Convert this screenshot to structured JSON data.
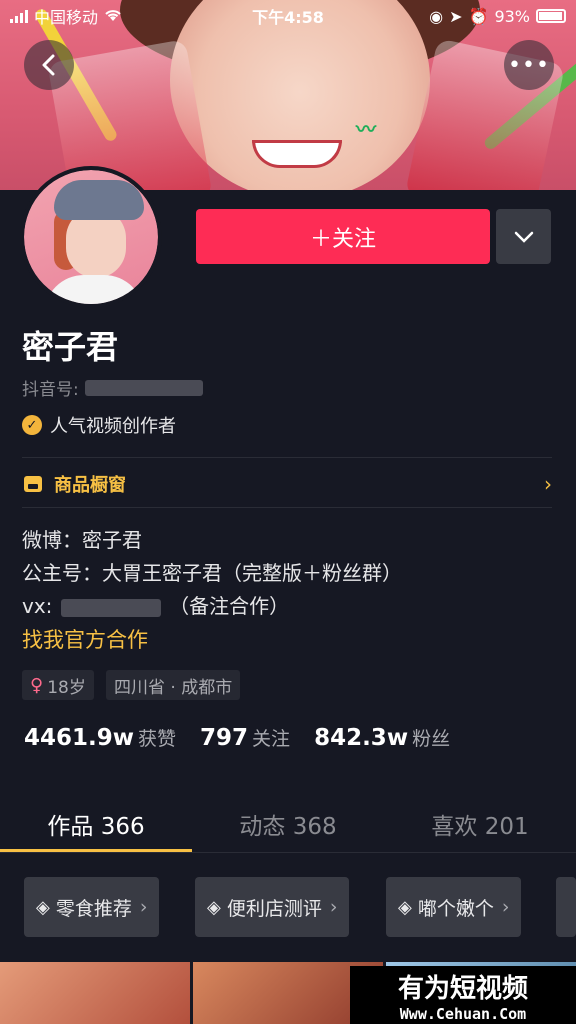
{
  "status_bar": {
    "carrier": "中国移动",
    "time": "下午4:58",
    "battery": "93%"
  },
  "header": {
    "back_icon": "back-arrow-icon",
    "more_icon": "more-dots-icon"
  },
  "profile": {
    "follow_label": "＋关注",
    "name": "密子君",
    "douyin_id_label": "抖音号:",
    "badge_label": "人气视频创作者",
    "shop_label": "商品橱窗",
    "bio": {
      "weibo": "微博：密子君",
      "gongzhuhao": "公主号：大胃王密子君（完整版＋粉丝群）",
      "vx_prefix": "vx:",
      "vx_suffix": "（备注合作）"
    },
    "official_cooperation": "找我官方合作",
    "age": "18岁",
    "location": "四川省 · 成都市"
  },
  "stats": [
    {
      "value": "4461.9w",
      "label": "获赞"
    },
    {
      "value": "797",
      "label": "关注"
    },
    {
      "value": "842.3w",
      "label": "粉丝"
    }
  ],
  "tabs": [
    {
      "label": "作品 366",
      "active": true
    },
    {
      "label": "动态 368",
      "active": false
    },
    {
      "label": "喜欢 201",
      "active": false
    }
  ],
  "collections": [
    {
      "label": "零食推荐"
    },
    {
      "label": "便利店测评"
    },
    {
      "label": "嘟个嫩个"
    }
  ],
  "watermark": {
    "title": "有为短视频",
    "url": "Www.Cehuan.Com"
  },
  "colors": {
    "background": "#161823",
    "follow_button": "#fe2c55",
    "accent_yellow": "#f7c044"
  }
}
